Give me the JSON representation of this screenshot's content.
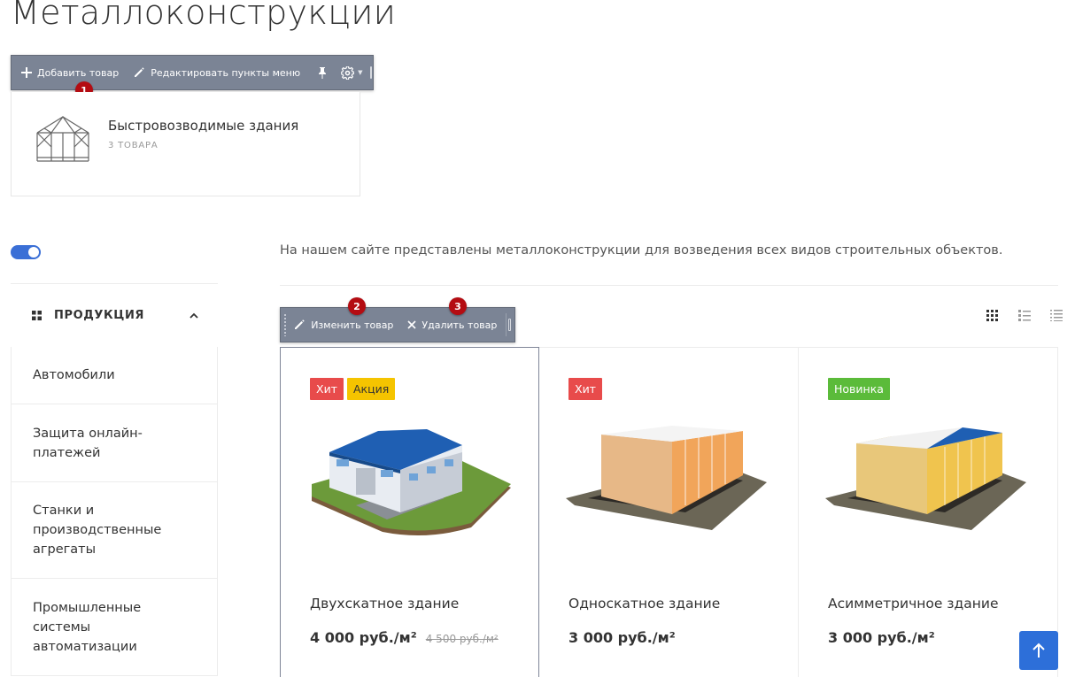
{
  "page": {
    "title": "Металлоконструкции"
  },
  "toolbar_top": {
    "add_label": "Добавить товар",
    "edit_menu_label": "Редактировать пункты меню",
    "marker": "1"
  },
  "section": {
    "name": "Быстровозводимые здания",
    "count": "3 товара"
  },
  "description": "На нашем сайте представлены металлоконструкции для возведения всех видов строительных объектов.",
  "sidebar": {
    "header": "ПРОДУКЦИЯ",
    "items": [
      {
        "label": "Автомобили"
      },
      {
        "label": "Защита онлайн-платежей"
      },
      {
        "label": "Станки и производственные агрегаты"
      },
      {
        "label": "Промышленные системы автоматизации"
      }
    ]
  },
  "toolbar_item": {
    "edit_label": "Изменить товар",
    "delete_label": "Удалить товар",
    "marker_edit": "2",
    "marker_delete": "3"
  },
  "products": [
    {
      "name": "Двухскатное здание",
      "price": "4 000 руб./м²",
      "old_price": "4 500 руб./м²",
      "badges": [
        {
          "label": "Хит",
          "color": "#e84b4b"
        },
        {
          "label": "Акция",
          "color": "#f5c400"
        }
      ]
    },
    {
      "name": "Односкатное здание",
      "price": "3 000 руб./м²",
      "old_price": "",
      "badges": [
        {
          "label": "Хит",
          "color": "#e84b4b"
        }
      ]
    },
    {
      "name": "Асимметричное здание",
      "price": "3 000 руб./м²",
      "old_price": "",
      "badges": [
        {
          "label": "Новинка",
          "color": "#5bbb3a"
        }
      ]
    }
  ],
  "colors": {
    "accent": "#2d6fd9",
    "admin_toolbar": "#7b8495",
    "marker": "#b40c12"
  },
  "icons": [
    "plus-icon",
    "pencil-icon",
    "pin-icon",
    "gear-icon",
    "close-icon",
    "grid-view-icon",
    "list-view-icon",
    "price-list-view-icon",
    "arrow-up-icon",
    "chevron-up-icon",
    "catalog-grid-icon"
  ]
}
